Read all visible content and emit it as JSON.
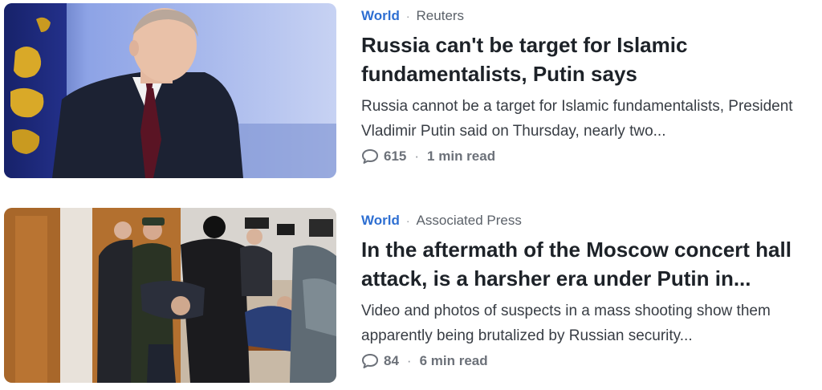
{
  "articles": [
    {
      "category": "World",
      "source": "Reuters",
      "headline": "Russia can't be target for Islamic fundamentalists, Putin says",
      "summary": "Russia cannot be a target for Islamic fundamentalists, President Vladimir Putin said on Thursday, nearly two...",
      "comments": "615",
      "read_time": "1 min read",
      "thumbnail_icon": "news-photo-man-in-suit"
    },
    {
      "category": "World",
      "source": "Associated Press",
      "headline": "In the aftermath of the Moscow concert hall attack, is a harsher era under Putin in...",
      "summary": "Video and photos of suspects in a mass shooting show them apparently being brutalized by Russian security...",
      "comments": "84",
      "read_time": "6 min read",
      "thumbnail_icon": "news-photo-crowd-courtroom"
    }
  ],
  "separator": "·",
  "colors": {
    "category": "#2e6fd2",
    "headline": "#1d2228",
    "summary": "#383d44",
    "meta": "#5b6169"
  }
}
